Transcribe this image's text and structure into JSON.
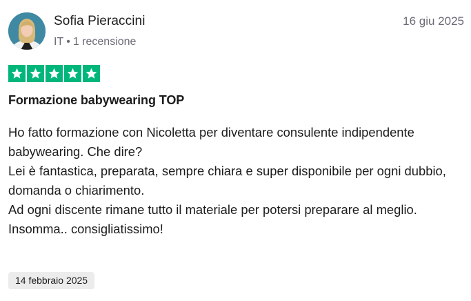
{
  "review": {
    "reviewer": {
      "name": "Sofia Pieraccini",
      "country": "IT",
      "separator": "•",
      "review_count": "1 recensione"
    },
    "date": "16 giu 2025",
    "rating": 5,
    "rating_max": 5,
    "title": "Formazione babywearing TOP",
    "body_lines": [
      "Ho fatto formazione con Nicoletta per diventare consulente indipendente babywearing. Che dire?",
      "Lei è fantastica, preparata, sempre chiara e super disponibile per ogni dubbio, domanda o chiarimento.",
      "Ad ogni discente rimane tutto il materiale per potersi preparare al meglio.",
      "Insomma.. consigliatissimo!"
    ],
    "experience_date": "14 febbraio 2025"
  },
  "colors": {
    "star_fill": "#00b67a",
    "muted_text": "#6b6b76",
    "badge_bg": "#ececec"
  },
  "icons": {
    "star": "star-icon"
  }
}
